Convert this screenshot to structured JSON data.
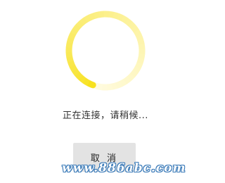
{
  "dialog": {
    "status_text": "正在连接，请稍候...",
    "cancel_label": "取 消"
  },
  "spinner": {
    "color_strong": "#f7e11c",
    "color_faint": "#fffbe0"
  },
  "watermark": {
    "text": "www.886abc.com"
  }
}
